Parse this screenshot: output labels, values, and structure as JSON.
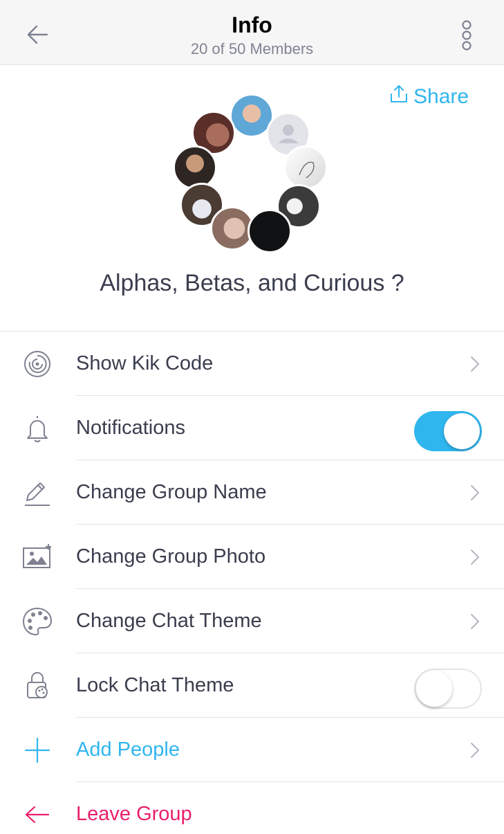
{
  "header": {
    "title": "Info",
    "subtitle": "20 of 50 Members"
  },
  "share": {
    "label": "Share"
  },
  "group": {
    "name": "Alphas, Betas, and Curious ?"
  },
  "menu": {
    "kik_code": "Show Kik Code",
    "notifications": "Notifications",
    "notifications_on": true,
    "change_name": "Change Group Name",
    "change_photo": "Change Group Photo",
    "change_theme": "Change Chat Theme",
    "lock_theme": "Lock Chat Theme",
    "lock_theme_on": false,
    "add_people": "Add People",
    "leave_group": "Leave Group"
  },
  "colors": {
    "accent": "#2fb6ee",
    "danger": "#ea1f6b",
    "text": "#3a3d4d"
  }
}
